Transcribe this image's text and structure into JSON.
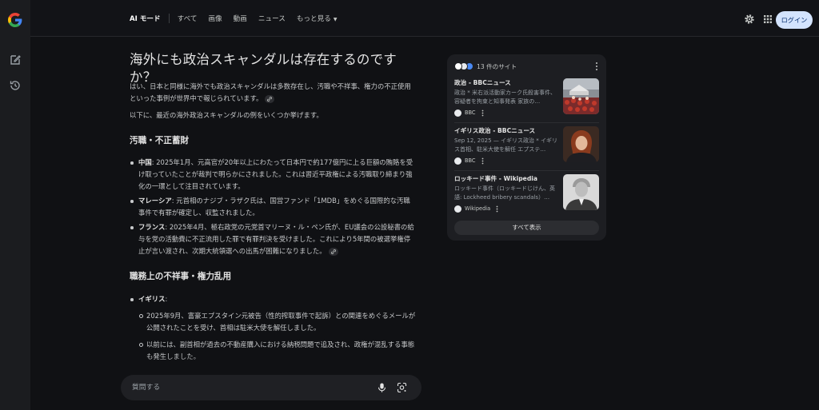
{
  "header": {
    "nav": [
      {
        "label": "AI モード",
        "active": true
      },
      {
        "label": "すべて"
      },
      {
        "label": "画像"
      },
      {
        "label": "動画"
      },
      {
        "label": "ニュース"
      },
      {
        "label": "もっと見る"
      }
    ],
    "login_label": "ログイン"
  },
  "answer": {
    "question": "海外にも政治スキャンダルは存在するのですか？",
    "intro": "はい、日本と同様に海外でも政治スキャンダルは多数存在し、汚職や不祥事、権力の不正使用といった事例が世界中で報じられています。",
    "intro2": "以下に、最近の海外政治スキャンダルの例をいくつか挙げます。",
    "section1": {
      "heading": "汚職・不正蓄財",
      "items": [
        {
          "label": "中国",
          "text": ": 2025年1月、元高官が20年以上にわたって日本円で約177億円に上る巨額の賄賂を受け取っていたことが裁判で明らかにされました。これは習近平政権による汚職取り締まり強化の一環として注目されています。"
        },
        {
          "label": "マレーシア",
          "text": ": 元首相のナジブ・ラザク氏は、国営ファンド「1MDB」をめぐる国際的な汚職事件で有罪が確定し、収監されました。"
        },
        {
          "label": "フランス",
          "text": ": 2025年4月、極右政党の元党首マリーヌ・ル・ペン氏が、EU議会の公設秘書の給与を党の活動費に不正流用した罪で有罪判決を受けました。これにより5年間の被選挙権停止が言い渡され、次期大統領選への出馬が困難になりました。"
        }
      ]
    },
    "section2": {
      "heading": "職務上の不祥事・権力乱用",
      "items": [
        {
          "label": "イギリス",
          "text": ":"
        }
      ],
      "subitems": [
        "2025年9月、富豪エプスタイン元被告（性的搾取事件で起訴）との関連をめぐるメールが公開されたことを受け、首相は駐米大使を解任しました。",
        "以前には、副首相が過去の不動産購入における納税問題で追及され、政権が混乱する事態も発生しました。"
      ]
    }
  },
  "input": {
    "placeholder": "質問する"
  },
  "sources": {
    "count_label": "13 件のサイト",
    "cards": [
      {
        "title": "政治 - BBCニュース",
        "snippet": "政治 * 米右派活動家カーク氏殺害事件、容疑者を拘束と知事発表 家族の…",
        "source": "BBC"
      },
      {
        "title": "イギリス政治 - BBCニュース",
        "snippet": "Sep 12, 2025 — イギリス政治 * イギリス首相、駐米大使を解任 エプステ…",
        "source": "BBC"
      },
      {
        "title": "ロッキード事件 - Wikipedia",
        "snippet": "ロッキード事件（ロッキードじけん、英語: Lockheed bribery scandals）…",
        "source": "Wikipedia"
      }
    ],
    "show_all_label": "すべて表示"
  },
  "colors": {
    "background": "#101114",
    "panel": "#1d1e22",
    "login_bg": "#d3e3fd",
    "login_text": "#062e6f"
  }
}
